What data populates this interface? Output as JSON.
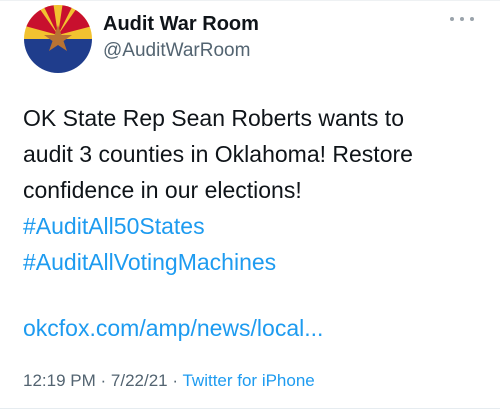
{
  "tweet": {
    "display_name": "Audit War Room",
    "handle": "@AuditWarRoom",
    "text_lines": [
      "OK State Rep Sean Roberts wants to",
      "audit 3 counties in Oklahoma! Restore",
      "confidence in our elections!"
    ],
    "hashtags": [
      "#AuditAll50States",
      "#AuditAllVotingMachines"
    ],
    "link": "okcfox.com/amp/news/local...",
    "time": "12:19 PM",
    "date": "7/22/21",
    "separator": "·",
    "source": "Twitter for iPhone"
  },
  "icons": {
    "avatar": "arizona-flag-avatar",
    "more": "more-options-icon"
  },
  "colors": {
    "link": "#1d9bf0",
    "secondary_text": "#536471",
    "primary_text": "#0f1419",
    "flag_red": "#c8102e",
    "flag_yellow": "#f2c230",
    "flag_blue": "#1f3d8c",
    "flag_star": "#b87333"
  }
}
